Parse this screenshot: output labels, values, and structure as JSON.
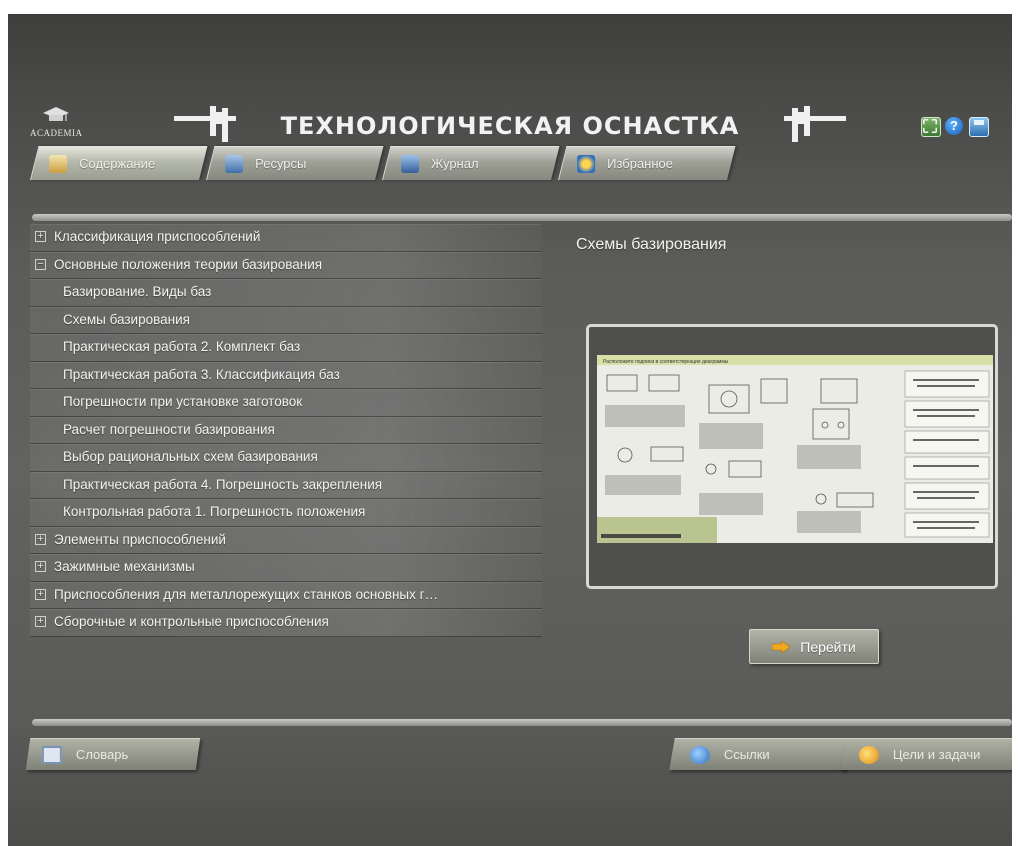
{
  "header": {
    "logo_text": "ACADEMIA",
    "title": "ТЕХНОЛОГИЧЕСКАЯ ОСНАСТКА",
    "icons": [
      "fullscreen-icon",
      "help-icon",
      "save-icon"
    ],
    "help_glyph": "?"
  },
  "tabs": [
    {
      "label": "Содержание",
      "icon": "contents-icon",
      "active": true
    },
    {
      "label": "Ресурсы",
      "icon": "resources-icon",
      "active": false
    },
    {
      "label": "Журнал",
      "icon": "journal-icon",
      "active": false
    },
    {
      "label": "Избранное",
      "icon": "favorites-icon",
      "active": false
    }
  ],
  "tree": {
    "items": [
      {
        "label": "Классификация приспособлений",
        "level": 0,
        "toggle": "+"
      },
      {
        "label": "Основные положения теории базирования",
        "level": 0,
        "toggle": "−"
      },
      {
        "label": "Базирование. Виды баз",
        "level": 1
      },
      {
        "label": "Схемы базирования",
        "level": 1
      },
      {
        "label": "Практическая работа 2. Комплект баз",
        "level": 1
      },
      {
        "label": "Практическая работа 3. Классификация баз",
        "level": 1
      },
      {
        "label": "Погрешности при установке заготовок",
        "level": 1
      },
      {
        "label": "Расчет погрешности базирования",
        "level": 1
      },
      {
        "label": "Выбор рациональных схем базирования",
        "level": 1
      },
      {
        "label": "Практическая работа 4. Погрешность закрепления",
        "level": 1
      },
      {
        "label": "Контрольная работа 1. Погрешность положения",
        "level": 1
      },
      {
        "label": "Элементы приспособлений",
        "level": 0,
        "toggle": "+"
      },
      {
        "label": "Зажимные механизмы",
        "level": 0,
        "toggle": "+"
      },
      {
        "label": "Приспособления для металлорежущих станков основных г…",
        "level": 0,
        "toggle": "+"
      },
      {
        "label": "Сборочные и контрольные приспособления",
        "level": 0,
        "toggle": "+"
      }
    ]
  },
  "content": {
    "title": "Схемы базирования",
    "preview_heading": "Расположите подписи в соответствующие диаграммы",
    "go_label": "Перейти"
  },
  "footer": {
    "dictionary_label": "Словарь",
    "links_label": "Ссылки",
    "goals_label": "Цели и задачи"
  },
  "colors": {
    "background": "#5a5a58",
    "text": "#f3f3f0",
    "tab": "#9fa197",
    "go_arrow": "#f0a820"
  }
}
